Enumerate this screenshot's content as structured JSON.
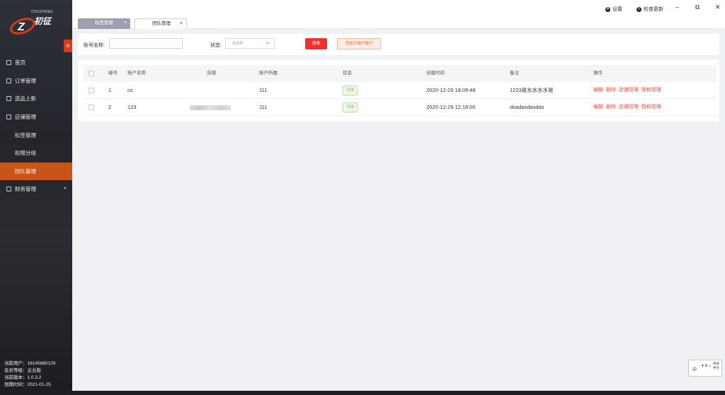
{
  "sidebar": {
    "logo": {
      "brand_en": "CHUZHENG",
      "brand_cn": "初征"
    },
    "collapse_icon": "«",
    "items": [
      {
        "label": "首页",
        "icon": "home-icon",
        "has_caret": false
      },
      {
        "label": "订单管理",
        "icon": "order-icon",
        "has_caret": false
      },
      {
        "label": "选品上新",
        "icon": "product-icon",
        "has_caret": false
      },
      {
        "label": "店铺管理",
        "icon": "store-icon",
        "has_caret": false
      },
      {
        "label": "标签管理",
        "sub": true
      },
      {
        "label": "权限分组",
        "sub": true
      },
      {
        "label": "团队管理",
        "sub": true,
        "active": true
      },
      {
        "label": "财务管理",
        "icon": "finance-icon",
        "has_caret": true
      }
    ],
    "user_info": {
      "current_user": "当前用户：18145880129",
      "member_level": "会员等级：企业版",
      "version": "当前版本：1.0.3.2",
      "expire": "到期时间：2021-01-25"
    }
  },
  "topbar": {
    "settings_label": "设置",
    "update_label": "检查更新",
    "minimize": "–",
    "restore": "⧉",
    "close": "✕"
  },
  "tabs": [
    {
      "label": "标签管理",
      "close": "×",
      "active": false
    },
    {
      "label": "团队管理",
      "close": "×",
      "active": true
    }
  ],
  "search": {
    "account_label": "账号名称:",
    "account_value": "",
    "status_label": "状态:",
    "status_placeholder": "请选择",
    "search_button": "搜索",
    "add_button": "添加子用户账户"
  },
  "table": {
    "columns": [
      "编号",
      "账户名称",
      "店铺",
      "账户所属",
      "状态",
      "创建时间",
      "备注",
      "操作"
    ],
    "rows": [
      {
        "id": "1",
        "name": "cs",
        "store": "",
        "owner": "111",
        "status": "可用",
        "created": "2020-12-29 18:09:48",
        "remark": "1223是水水水水是",
        "ops": [
          "编辑",
          "删除",
          "店铺管理",
          "授权管理"
        ]
      },
      {
        "id": "2",
        "name": "123",
        "store": "",
        "owner": "111",
        "status": "可用",
        "created": "2020-12-29 12:18:00",
        "remark": "dsadasdasdas",
        "ops": [
          "编辑",
          "删除",
          "店铺管理",
          "授权管理"
        ]
      }
    ]
  },
  "ime_widget": {
    "zh": "中",
    "mid": "♥ ⚙ ◗",
    "vertical": "简体中文 ·"
  },
  "colors": {
    "accent": "#f0302b",
    "active_menu": "#c7551a",
    "success": "#67c23a"
  }
}
